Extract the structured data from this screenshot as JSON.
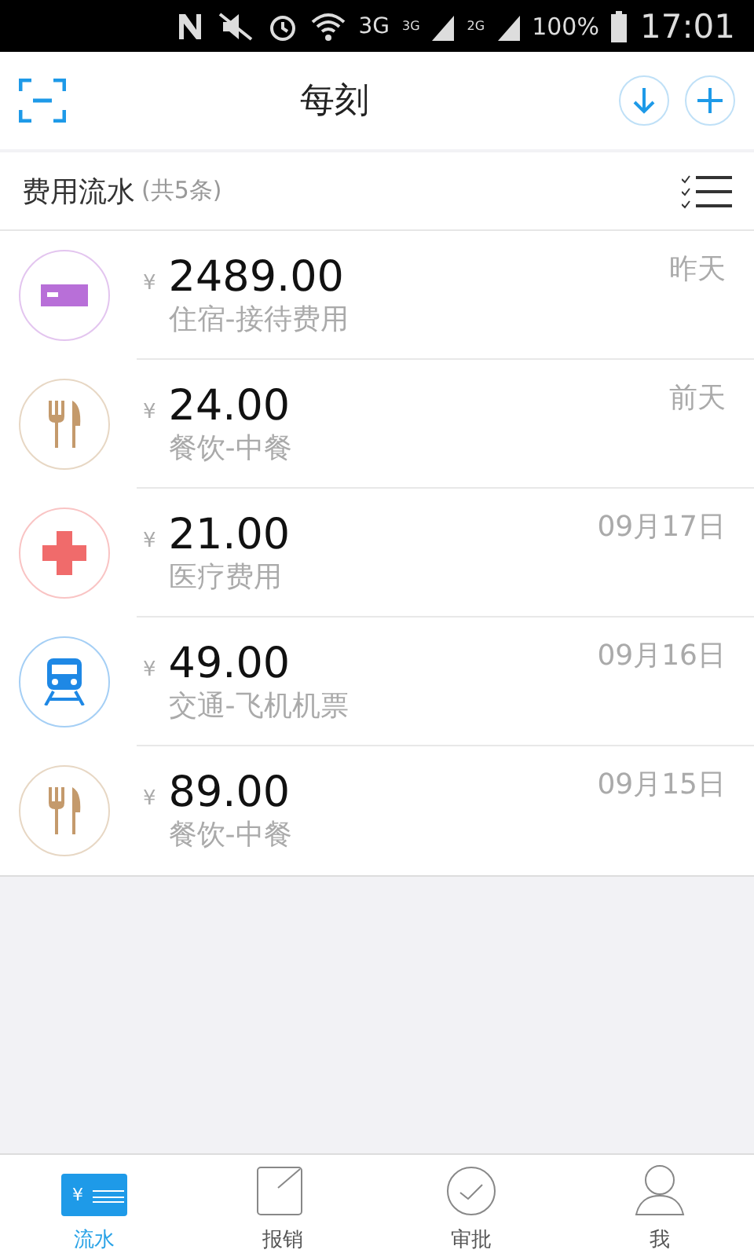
{
  "status_bar": {
    "network": "3G",
    "signals": [
      "3G",
      "2G"
    ],
    "battery": "100%",
    "time": "17:01"
  },
  "header": {
    "title": "每刻"
  },
  "section": {
    "title": "费用流水",
    "count": "(共5条)"
  },
  "expenses": [
    {
      "kind": "lodging",
      "color": "#b86fd8",
      "currency": "¥",
      "amount": "2489.00",
      "category": "住宿-接待费用",
      "date": "昨天"
    },
    {
      "kind": "food",
      "color": "#c49a6c",
      "currency": "¥",
      "amount": "24.00",
      "category": "餐饮-中餐",
      "date": "前天"
    },
    {
      "kind": "medical",
      "color": "#f06b6b",
      "currency": "¥",
      "amount": "21.00",
      "category": "医疗费用",
      "date": "09月17日"
    },
    {
      "kind": "transport",
      "color": "#1e88e5",
      "currency": "¥",
      "amount": "49.00",
      "category": "交通-飞机机票",
      "date": "09月16日"
    },
    {
      "kind": "food",
      "color": "#c49a6c",
      "currency": "¥",
      "amount": "89.00",
      "category": "餐饮-中餐",
      "date": "09月15日"
    }
  ],
  "tabs": [
    {
      "kind": "flow",
      "label": "流水",
      "icon_text": "¥",
      "selected": true
    },
    {
      "kind": "reimburse",
      "label": "报销",
      "selected": false
    },
    {
      "kind": "approve",
      "label": "审批",
      "selected": false
    },
    {
      "kind": "me",
      "label": "我",
      "selected": false
    }
  ]
}
